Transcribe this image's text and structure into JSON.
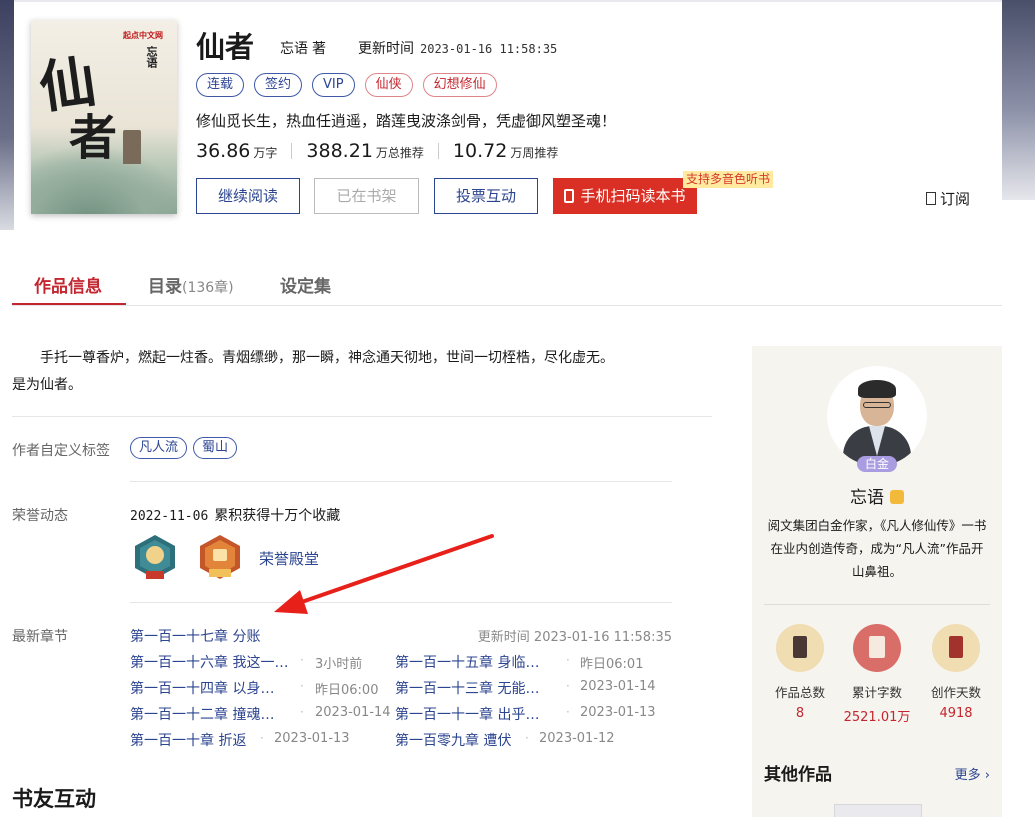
{
  "cover": {
    "site": "起点中文网",
    "author_mark": "忘语",
    "title_chars": [
      "仙",
      "者"
    ]
  },
  "book": {
    "title": "仙者",
    "author": "忘语",
    "author_suffix": "著",
    "updated_label": "更新时间",
    "updated_value": "2023-01-16 11:58:35",
    "tags": [
      {
        "label": "连载",
        "style": "blue"
      },
      {
        "label": "签约",
        "style": "blue"
      },
      {
        "label": "VIP",
        "style": "blue"
      },
      {
        "label": "仙侠",
        "style": "red"
      },
      {
        "label": "幻想修仙",
        "style": "red"
      }
    ],
    "intro": "修仙觅长生，热血任逍遥，踏莲曳波涤剑骨，凭虚御风塑圣魂！",
    "stats": [
      {
        "num": "36.86",
        "unit": "万字"
      },
      {
        "num": "388.21",
        "unit": "万总推荐"
      },
      {
        "num": "10.72",
        "unit": "万周推荐"
      }
    ]
  },
  "actions": {
    "read": "继续阅读",
    "shelf": "已在书架",
    "vote": "投票互动",
    "scan": "手机扫码读本书",
    "audio_badge": "支持多音色听书",
    "subscribe": "订阅"
  },
  "tabs": [
    {
      "label": "作品信息",
      "count": ""
    },
    {
      "label": "目录",
      "count": "(136章)"
    },
    {
      "label": "设定集",
      "count": ""
    }
  ],
  "summary": {
    "line1": "手托一尊香炉，燃起一炷香。青烟缥缈，那一瞬，神念通天彻地，世间一切桎梏，尽化虚无。",
    "line2": "是为仙者。"
  },
  "custom_tags": {
    "label": "作者自定义标签",
    "items": [
      "凡人流",
      "蜀山"
    ]
  },
  "honor": {
    "label": "荣誉动态",
    "date": "2022-11-06",
    "text": "累积获得十万个收藏",
    "hall": "荣誉殿堂"
  },
  "chapters": {
    "label": "最新章节",
    "latest": "第一百一十七章 分账",
    "updated": "更新时间 2023-01-16 11:58:35",
    "list": [
      {
        "title": "第一百一十六章 我这一…",
        "time": "3小时前"
      },
      {
        "title": "第一百一十五章 身临…",
        "time": "昨日06:01"
      },
      {
        "title": "第一百一十四章 以身…",
        "time": "昨日06:00"
      },
      {
        "title": "第一百一十三章 无能…",
        "time": "2023-01-14"
      },
      {
        "title": "第一百一十二章 撞魂…",
        "time": "2023-01-14"
      },
      {
        "title": "第一百一十一章 出乎…",
        "time": "2023-01-13"
      },
      {
        "title": "第一百一十章 折返",
        "time": "2023-01-13"
      },
      {
        "title": "第一百零九章 遭伏",
        "time": "2023-01-12"
      }
    ]
  },
  "forum_title": "书友互动",
  "author_card": {
    "level_badge": "白金",
    "name": "忘语",
    "desc": "阅文集团白金作家，《凡人修仙传》一书在业内创造传奇，成为“凡人流”作品开山鼻祖。",
    "stats": [
      {
        "label": "作品总数",
        "value": "8"
      },
      {
        "label": "累计字数",
        "value": "2521.01万"
      },
      {
        "label": "创作天数",
        "value": "4918"
      }
    ],
    "other_title": "其他作品",
    "more": "更多"
  },
  "colors": {
    "accent_red": "#c4262f",
    "link_blue": "#2c4590",
    "scan_red": "#d92f24",
    "arrow": "#e8201a"
  }
}
